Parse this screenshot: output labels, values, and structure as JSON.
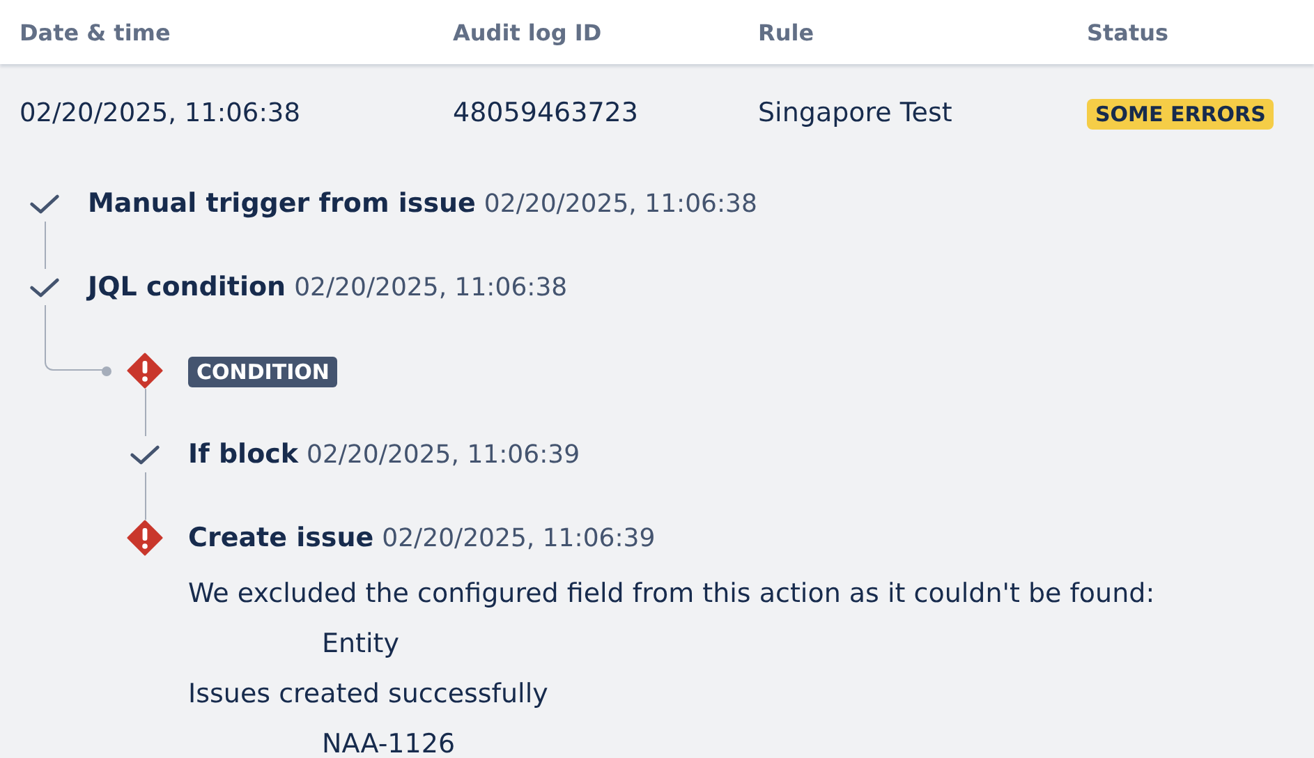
{
  "table": {
    "columns": [
      "Date & time",
      "Audit log ID",
      "Rule",
      "Status"
    ],
    "rows": [
      {
        "date_time": "02/20/2025, 11:06:38",
        "audit_log_id": "48059463723",
        "rule": "Singapore Test",
        "status": "SOME ERRORS"
      }
    ]
  },
  "log": [
    {
      "kind": "success",
      "title": "Manual trigger from issue",
      "time": "02/20/2025, 11:06:38"
    },
    {
      "kind": "success",
      "title": "JQL condition",
      "time": "02/20/2025, 11:06:38",
      "children": [
        {
          "kind": "error",
          "badge": "CONDITION",
          "children": [
            {
              "kind": "success",
              "title": "If block",
              "time": "02/20/2025, 11:06:39"
            },
            {
              "kind": "error",
              "title": "Create issue",
              "time": "02/20/2025, 11:06:39",
              "messages": [
                {
                  "text": "We excluded the configured field from this action as it couldn't be found:",
                  "values": [
                    "Entity"
                  ]
                },
                {
                  "text": "Issues created successfully",
                  "values": [
                    "NAA-1126"
                  ]
                }
              ]
            }
          ]
        }
      ]
    }
  ]
}
